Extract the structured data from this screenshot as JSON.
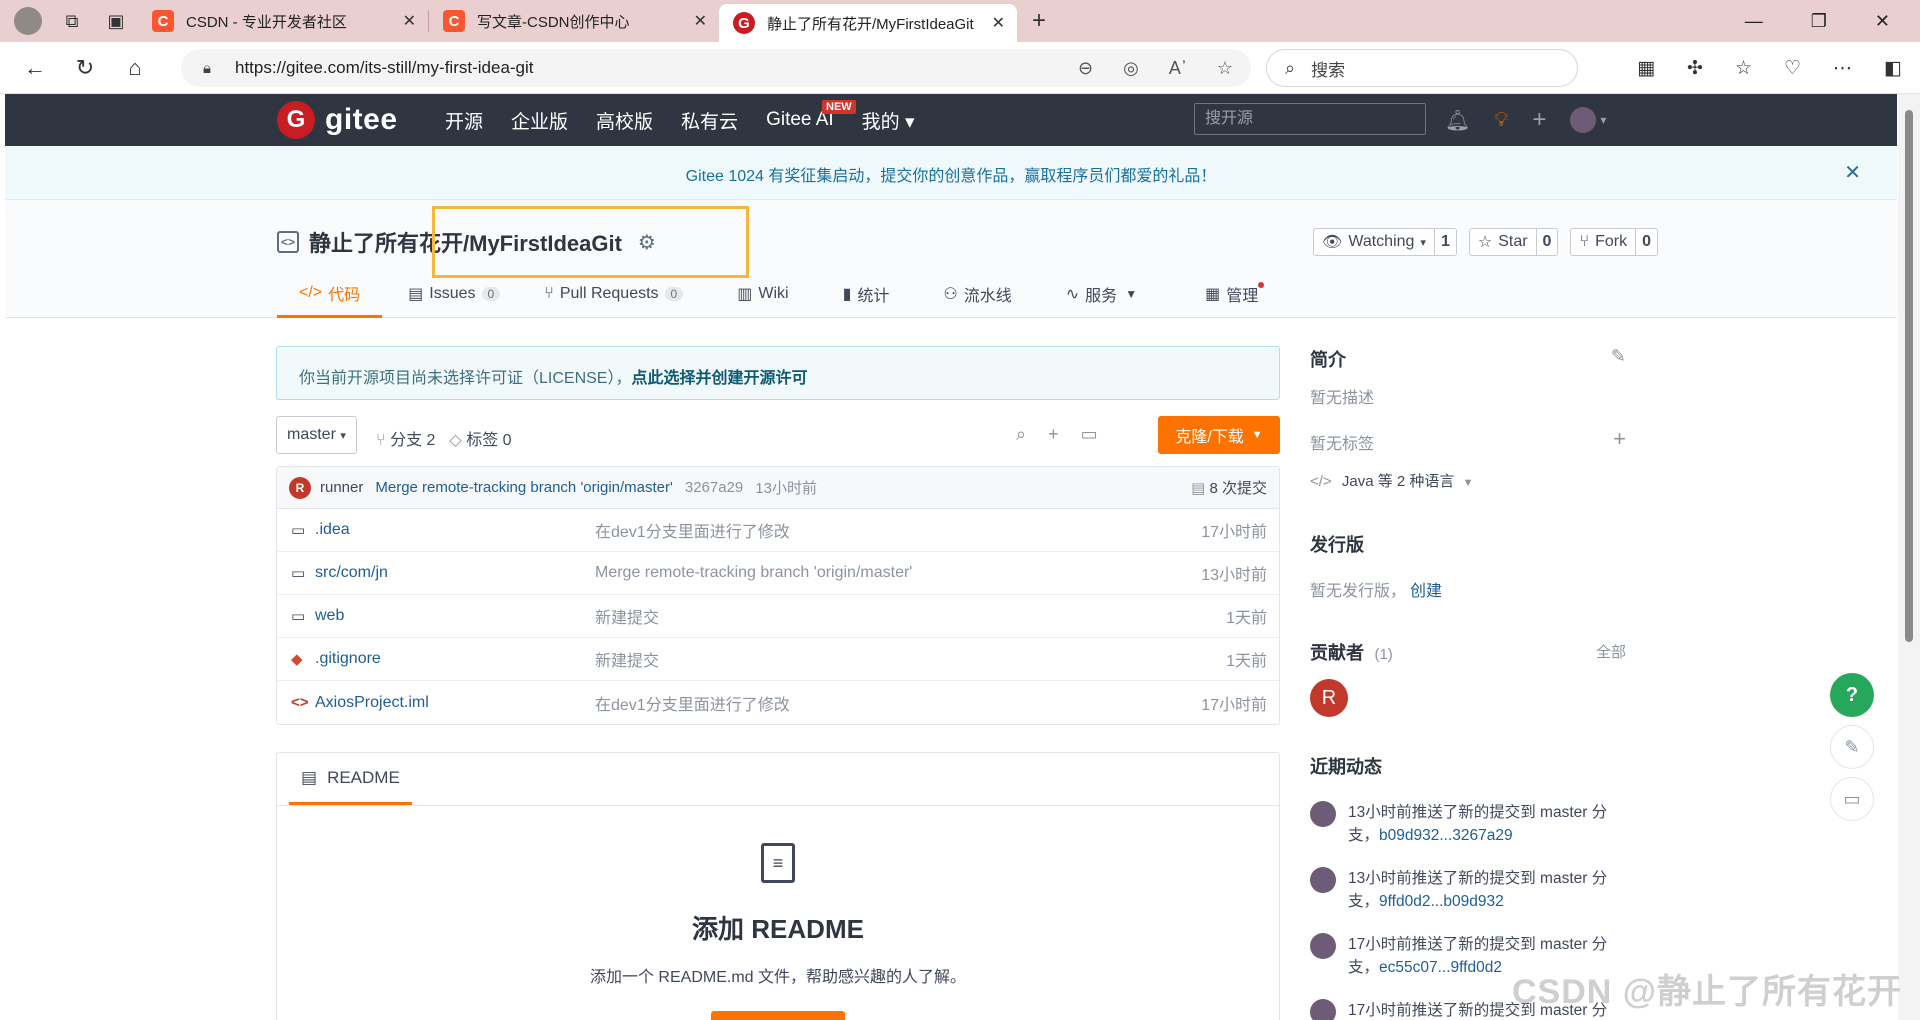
{
  "browser": {
    "tabs": [
      {
        "label": "CSDN - 专业开发者社区",
        "favicon": "C"
      },
      {
        "label": "写文章-CSDN创作中心",
        "favicon": "C"
      },
      {
        "label": "静止了所有花开/MyFirstIdeaGit",
        "favicon": "G"
      }
    ],
    "url": "https://gitee.com/its-still/my-first-idea-git",
    "search_placeholder": "搜索"
  },
  "gitee": {
    "logo_text": "gitee",
    "nav": [
      "开源",
      "企业版",
      "高校版",
      "私有云",
      "Gitee AI",
      "我的"
    ],
    "new_badge": "NEW",
    "search_placeholder": "搜开源"
  },
  "notice": "Gitee 1024 有奖征集启动，提交你的创意作品，赢取程序员们都爱的礼品！",
  "repo": {
    "title": "静止了所有花开/MyFirstIdeaGit",
    "watching": {
      "label": "Watching",
      "count": "1"
    },
    "star": {
      "label": "Star",
      "count": "0"
    },
    "fork": {
      "label": "Fork",
      "count": "0"
    },
    "tabs": {
      "code": "代码",
      "issues": "Issues",
      "issues_count": "0",
      "pulls": "Pull Requests",
      "pulls_count": "0",
      "wiki": "Wiki",
      "stats": "统计",
      "pipeline": "流水线",
      "services": "服务",
      "manage": "管理"
    }
  },
  "license_notice": {
    "text": "你当前开源项目尚未选择许可证（LICENSE），",
    "link": "点此选择并创建开源许可"
  },
  "toolbar": {
    "branch": "master",
    "branches": "分支 2",
    "tags": "标签 0",
    "clone": "克隆/下载"
  },
  "commit": {
    "avatar": "R",
    "author": "runner",
    "message": "Merge remote-tracking branch 'origin/master'",
    "hash": "3267a29",
    "time": "13小时前",
    "count": "8 次提交"
  },
  "files": [
    {
      "name": ".idea",
      "type": "folder",
      "message": "在dev1分支里面进行了修改",
      "time": "17小时前"
    },
    {
      "name": "src/com/jn",
      "type": "folder",
      "message": "Merge remote-tracking branch 'origin/master'",
      "time": "13小时前"
    },
    {
      "name": "web",
      "type": "folder",
      "message": "新建提交",
      "time": "1天前"
    },
    {
      "name": ".gitignore",
      "type": "git",
      "message": "新建提交",
      "time": "1天前"
    },
    {
      "name": "AxiosProject.iml",
      "type": "code",
      "message": "在dev1分支里面进行了修改",
      "time": "17小时前"
    }
  ],
  "readme": {
    "tab": "README",
    "heading": "添加 README",
    "desc": "添加一个 README.md 文件，帮助感兴趣的人了解。"
  },
  "sidebar": {
    "intro_title": "简介",
    "no_desc": "暂无描述",
    "no_tags": "暂无标签",
    "languages": "Java 等 2 种语言",
    "release_title": "发行版",
    "no_release": "暂无发行版，",
    "create": "创建",
    "contributors_title": "贡献者",
    "contributors_count": "(1)",
    "all": "全部",
    "contributor_avatar": "R",
    "activity_title": "近期动态",
    "activities": [
      {
        "text": "13小时前推送了新的提交到 master 分支，",
        "link": "b09d932...3267a29"
      },
      {
        "text": "13小时前推送了新的提交到 master 分支，",
        "link": "9ffd0d2...b09d932"
      },
      {
        "text": "17小时前推送了新的提交到 master 分支，",
        "link": "ec55c07...9ffd0d2"
      },
      {
        "text": "17小时前推送了新的提交到 master 分"
      }
    ]
  },
  "help_button": "?",
  "watermark": "CSDN @静止了所有花开"
}
